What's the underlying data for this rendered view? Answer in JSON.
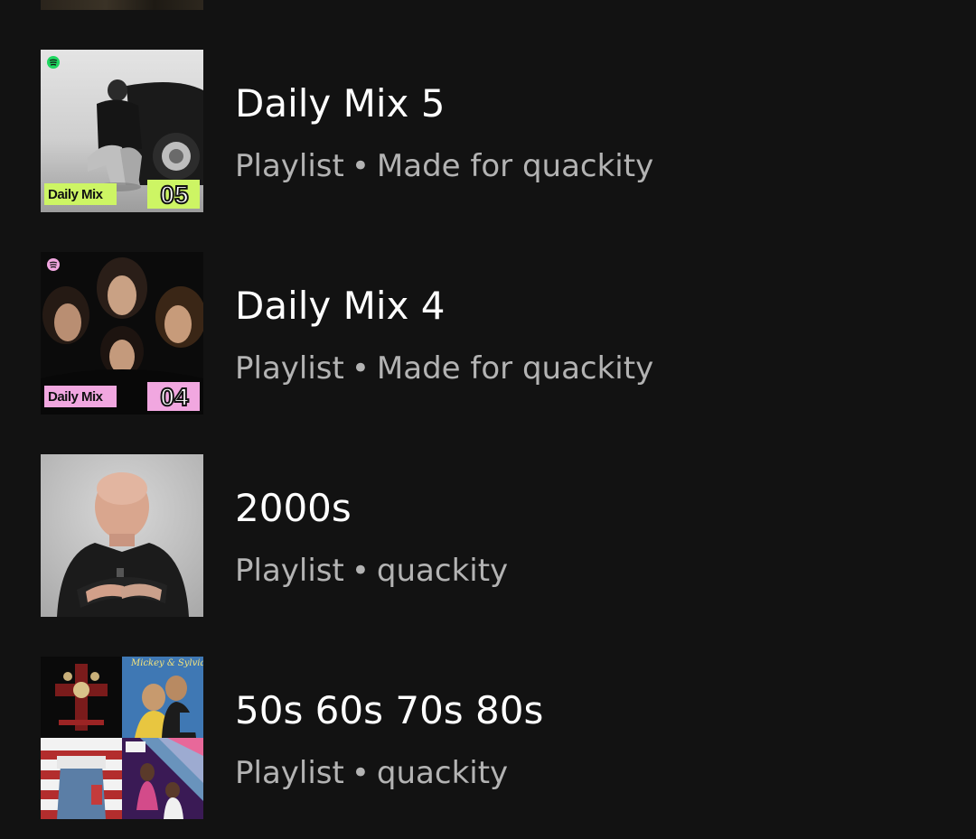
{
  "items": [
    {
      "title": "Daily Mix 5",
      "type": "Playlist",
      "separator": "•",
      "owner": "Made for quackity",
      "cover": {
        "kind": "daily-mix",
        "badge_label": "Daily Mix",
        "badge_number": "05",
        "badge_color": "#cdf564"
      }
    },
    {
      "title": "Daily Mix 4",
      "type": "Playlist",
      "separator": "•",
      "owner": "Made for quackity",
      "cover": {
        "kind": "daily-mix",
        "badge_label": "Daily Mix",
        "badge_number": "04",
        "badge_color": "#f1a7e0"
      }
    },
    {
      "title": "2000s",
      "type": "Playlist",
      "separator": "•",
      "owner": "quackity",
      "cover": {
        "kind": "photo"
      }
    },
    {
      "title": "50s 60s 70s 80s",
      "type": "Playlist",
      "separator": "•",
      "owner": "quackity",
      "cover": {
        "kind": "mosaic",
        "tile_text": "Mickey & Sylvia"
      }
    }
  ],
  "colors": {
    "background": "#121212",
    "title": "#ffffff",
    "subtitle": "#b3b3b3"
  }
}
